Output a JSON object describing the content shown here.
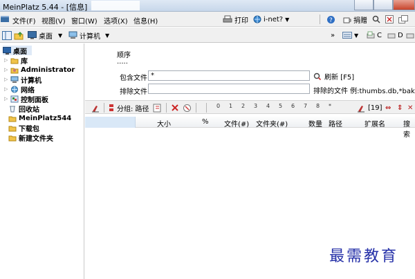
{
  "window": {
    "title": "MeinPlatz 5.44 - [信息]"
  },
  "menu": {
    "items": [
      "文件(F)",
      "视图(V)",
      "窗口(W)",
      "选项(X)",
      "信息(H)"
    ],
    "print": "打印",
    "inet": "i-net?",
    "donate": "捐赠"
  },
  "nav": {
    "desktop": "桌面",
    "computer": "计算机"
  },
  "tree": [
    {
      "label": "桌面",
      "bold": true,
      "selected": true
    },
    {
      "label": "库",
      "bold": true
    },
    {
      "label": "Administrator",
      "bold": true
    },
    {
      "label": "计算机",
      "bold": true
    },
    {
      "label": "网络",
      "bold": true
    },
    {
      "label": "控制面板",
      "bold": true
    },
    {
      "label": "回收站",
      "bold": true
    },
    {
      "label": "MeinPlatz544",
      "bold": true
    },
    {
      "label": "下载包",
      "bold": true
    },
    {
      "label": "新建文件夹",
      "bold": true
    }
  ],
  "filter": {
    "order_label": "顺序",
    "order_value": ".....",
    "include_label": "包含文件",
    "include_value": "*",
    "refresh_label": "刷新 [F5]",
    "exclude_label": "排除文件",
    "exclude_value": "",
    "exclude_example": "排除的文件 例:thumbs.db,*bak"
  },
  "toolbar2": {
    "group_label": "分组: 路径",
    "cols": [
      "0",
      "1",
      "2",
      "3",
      "4",
      "5",
      "6",
      "7",
      "8",
      "*"
    ],
    "count": "[19]"
  },
  "columns": [
    "大小",
    "%",
    "文件(#)",
    "文件夹(#)",
    "数量",
    "路径",
    "扩展名",
    "搜索"
  ],
  "watermark": "最需教育"
}
